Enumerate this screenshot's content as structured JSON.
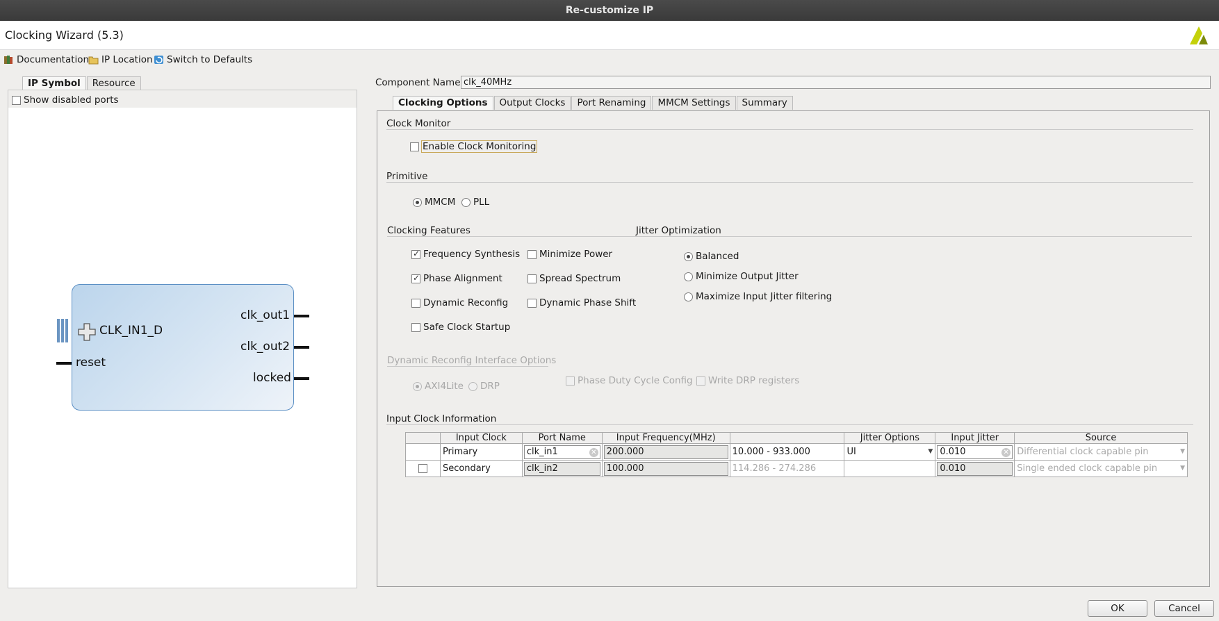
{
  "window": {
    "title": "Re-customize IP"
  },
  "header": {
    "wizard_title": "Clocking Wizard (5.3)"
  },
  "toolbar": {
    "documentation": "Documentation",
    "ip_location": "IP Location",
    "switch_defaults": "Switch to Defaults"
  },
  "left": {
    "tabs": [
      {
        "label": "IP Symbol"
      },
      {
        "label": "Resource"
      }
    ],
    "show_disabled_ports": "Show disabled ports",
    "symbol": {
      "input_port": "CLK_IN1_D",
      "reset_port": "reset",
      "outputs": [
        "clk_out1",
        "clk_out2",
        "locked"
      ]
    }
  },
  "component": {
    "label": "Component Name",
    "value": "clk_40MHz"
  },
  "tabs": [
    {
      "label": "Clocking Options"
    },
    {
      "label": "Output Clocks"
    },
    {
      "label": "Port Renaming"
    },
    {
      "label": "MMCM Settings"
    },
    {
      "label": "Summary"
    }
  ],
  "clock_monitor": {
    "title": "Clock Monitor",
    "enable": "Enable Clock Monitoring"
  },
  "primitive": {
    "title": "Primitive",
    "mmcm": "MMCM",
    "pll": "PLL"
  },
  "features": {
    "title": "Clocking Features",
    "frequency_synthesis": "Frequency Synthesis",
    "minimize_power": "Minimize Power",
    "phase_alignment": "Phase Alignment",
    "spread_spectrum": "Spread Spectrum",
    "dynamic_reconfig": "Dynamic Reconfig",
    "dynamic_phase_shift": "Dynamic Phase Shift",
    "safe_clock_startup": "Safe Clock Startup"
  },
  "jitter": {
    "title": "Jitter Optimization",
    "balanced": "Balanced",
    "min_output": "Minimize Output Jitter",
    "max_input": "Maximize Input Jitter filtering"
  },
  "drp": {
    "title": "Dynamic Reconfig Interface Options",
    "axi4lite": "AXI4Lite",
    "drp": "DRP",
    "phase_duty": "Phase Duty Cycle Config",
    "write_drp": "Write DRP registers"
  },
  "input_clock": {
    "title": "Input Clock Information",
    "headers": [
      "Input Clock",
      "Port Name",
      "Input Frequency(MHz)",
      "",
      "Jitter Options",
      "Input Jitter",
      "Source"
    ],
    "rows": [
      {
        "name": "Primary",
        "port": "clk_in1",
        "freq": "200.000",
        "range": "10.000 - 933.000",
        "jitter_opt": "UI",
        "jitter": "0.010",
        "source": "Differential clock capable pin"
      },
      {
        "name": "Secondary",
        "port": "clk_in2",
        "freq": "100.000",
        "range": "114.286 - 274.286",
        "jitter_opt": "",
        "jitter": "0.010",
        "source": "Single ended clock capable pin"
      }
    ]
  },
  "buttons": {
    "ok": "OK",
    "cancel": "Cancel"
  }
}
